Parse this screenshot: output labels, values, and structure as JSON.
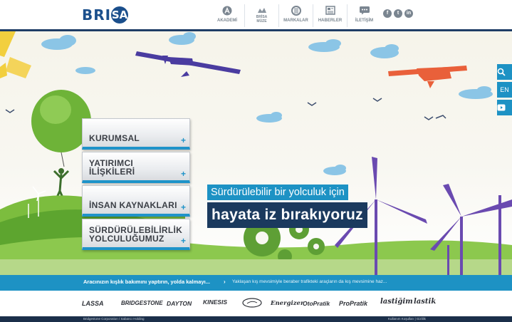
{
  "header": {
    "logo_text": "BRI",
    "logo_badge": "SA",
    "logo_text_end": "",
    "nav": [
      {
        "label": "AKADEMİ",
        "icon": "academy-icon"
      },
      {
        "label": "BRİSA\nMÜZE",
        "icon": "museum-icon"
      },
      {
        "label": "MARKALAR",
        "icon": "tire-icon"
      },
      {
        "label": "HABERLER",
        "icon": "newspaper-icon"
      },
      {
        "label": "İLETİŞİM",
        "icon": "contact-icon"
      }
    ],
    "social": [
      {
        "label": "f",
        "icon": "facebook-icon"
      },
      {
        "label": "t",
        "icon": "twitter-icon"
      },
      {
        "label": "in",
        "icon": "linkedin-icon"
      }
    ]
  },
  "menu": [
    {
      "label": "KURUMSAL"
    },
    {
      "label": "YATIRIMCI İLİŞKİLERİ"
    },
    {
      "label": "İNSAN KAYNAKLARI"
    },
    {
      "label": "SÜRDÜRÜLEBİLİRLİK YOLCULUĞUMUZ"
    }
  ],
  "menu_plus": "+",
  "hero": {
    "line1": "Sürdürülebilir bir yolculuk için",
    "line2": "hayata iz bırakıyoruz"
  },
  "side_buttons": {
    "search_icon": "search-icon",
    "language": "EN",
    "video_icon": "youtube-icon"
  },
  "ticker": {
    "main": "Aracınızın kışlık bakımını yaptırın, yolda kalmayı...",
    "arrow": "›",
    "next": "Yaklaşan kış mevsimiyle beraber trafikteki araçların da kış mevsimine haz..."
  },
  "brands": [
    "LASSA",
    "BRIDGESTONE",
    "DAYTON",
    "KINESIS",
    "",
    "Energizer",
    "OtoPratik",
    "ProPratik",
    "lastiğim",
    "lastik"
  ],
  "footer": {
    "left": "Bridgestone Corporation / Sabancı Holding",
    "right": "Kullanım Koşulları  |  Gizlilik"
  },
  "colors": {
    "brand_blue": "#1b4f8c",
    "accent_blue": "#1d92c4",
    "dark_navy": "#1b3a5e",
    "footer": "#1b2f4a"
  }
}
